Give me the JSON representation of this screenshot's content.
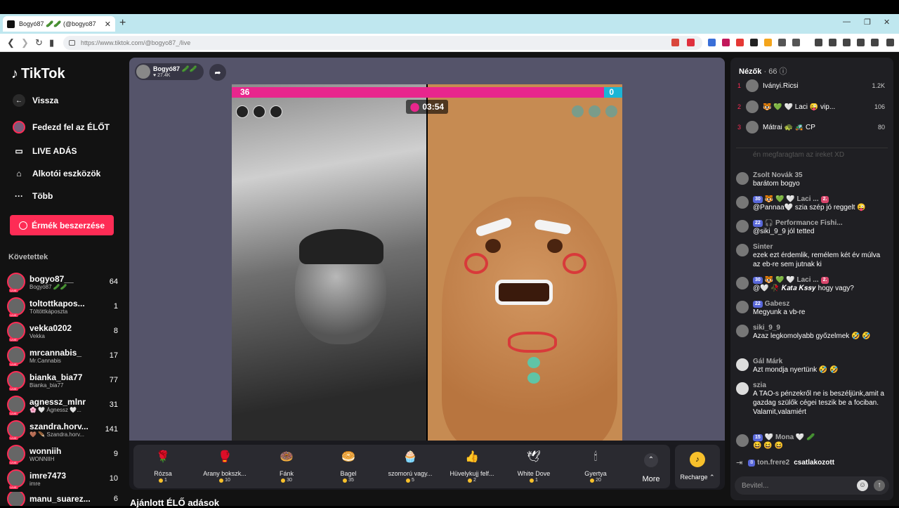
{
  "browser": {
    "tab_title": "Bogyó87 🥒🥒 (@bogyo87",
    "url": "https://www.tiktok.com/@bogyo87_/live"
  },
  "sidebar": {
    "logo": "TikTok",
    "nav": [
      {
        "label": "Vissza",
        "icon": "back-arrow-icon"
      },
      {
        "label": "Fedezd fel az ÉLŐT",
        "icon": "explore-live-icon"
      },
      {
        "label": "LIVE ADÁS",
        "icon": "video-camera-icon"
      },
      {
        "label": "Alkotói eszközök",
        "icon": "house-icon"
      },
      {
        "label": "Több",
        "icon": "more-icon"
      }
    ],
    "coin_button": "Érmék beszerzése",
    "following_label": "Követettek",
    "following": [
      {
        "name": "bogyo87__",
        "sub": "Bogyó87 🥒🥒",
        "count": "64"
      },
      {
        "name": "toltottkapos...",
        "sub": "Töltöttkáposzta",
        "count": "1"
      },
      {
        "name": "vekka0202",
        "sub": "Vekka",
        "count": "8"
      },
      {
        "name": "mrcannabis_",
        "sub": "Mr.Cannabis",
        "count": "17"
      },
      {
        "name": "bianka_bia77",
        "sub": "Bianka_bia77",
        "count": "77"
      },
      {
        "name": "agnessz_mlnr",
        "sub": "🌸 🤍 Ágnessz 🤍...",
        "count": "31"
      },
      {
        "name": "szandra.horv...",
        "sub": "🤎 🪶 Szandra.horv...",
        "count": "141"
      },
      {
        "name": "wonniih",
        "sub": "WONNIIH",
        "count": "9"
      },
      {
        "name": "imre7473",
        "sub": "imre",
        "count": "10"
      },
      {
        "name": "manu_suarez...",
        "sub": "",
        "count": "6"
      }
    ]
  },
  "stream": {
    "host_name": "Bogyó87 🥒🥒",
    "host_likes": "27.4K",
    "pk_left_score": "36",
    "pk_right_score": "0",
    "pk_fraction_left": 0.953,
    "timer": "03:54",
    "recommend_title": "Ajánlott ÉLŐ adások"
  },
  "gifts": [
    {
      "name": "Rózsa",
      "price": "1",
      "icon": "🌹"
    },
    {
      "name": "Arany bokszk...",
      "price": "10",
      "icon": "🥊"
    },
    {
      "name": "Fánk",
      "price": "30",
      "icon": "🍩"
    },
    {
      "name": "Bagel",
      "price": "35",
      "icon": "🥯"
    },
    {
      "name": "szomorú vagy...",
      "price": "5",
      "icon": "🧁"
    },
    {
      "name": "Hüvelykujj felf...",
      "price": "2",
      "icon": "👍"
    },
    {
      "name": "White Dove",
      "price": "1",
      "icon": "🕊"
    },
    {
      "name": "Gyertya",
      "price": "20",
      "icon": "🕯"
    }
  ],
  "gift_more": "More",
  "recharge": "Recharge",
  "chat": {
    "viewers_label": "Nézők",
    "viewers_count": "66",
    "top": [
      {
        "rank": "1",
        "name": "Iványi.Ricsi",
        "score": "1.2K"
      },
      {
        "rank": "2",
        "name": "🐯 💚 🤍 Laci 😜 vip...",
        "score": "106"
      },
      {
        "rank": "3",
        "name": "Mátrai 🐢 🚜 CP",
        "score": "80"
      }
    ],
    "faded_message": "én megfaragtam az ireket XD",
    "messages": [
      {
        "user": "Zsolt Novák 35",
        "badges": [],
        "text": "barátom bogyo"
      },
      {
        "user": "🐯 💚 🤍 Laci ...",
        "badges": [
          "30",
          "2."
        ],
        "text": "@Pannaa🤍 szia szép jó reggelt 😜"
      },
      {
        "user": "🎧 Performance Fishi...",
        "badges": [
          "22"
        ],
        "text": "@siki_9_9 jól tetted"
      },
      {
        "user": "Sinter",
        "badges": [],
        "text": "ezek ezt érdemlik, remélem két év múlva az eb-re sem jutnak ki"
      },
      {
        "user": "🐯 💚 🤍 Laci ...",
        "badges": [
          "30",
          "2."
        ],
        "text": "@🤍 🥀 𝑲𝒂𝒕𝒂 𝑲𝒔𝒔𝒚 hogy vagy?"
      },
      {
        "user": "Gabesz",
        "badges": [
          "22"
        ],
        "text": "Megyunk a vb-re"
      },
      {
        "user": "siki_9_9",
        "badges": [],
        "text": "Azaz legkomolyabb győzelmek 🤣 🤣"
      },
      {
        "user": "Gál Márk",
        "badges": [],
        "text": "Azt mondja nyertünk 🤣 🤣"
      },
      {
        "user": "szia",
        "badges": [],
        "text": "A TAO-s pénzekről ne is beszéljünk,amit a gazdag szülők cégei teszik be a fociban. Valamit,valamiért"
      },
      {
        "user": "🤍 Mona 🤍 🥒",
        "badges": [
          "15"
        ],
        "text": "😆 😆 😆"
      }
    ],
    "join": {
      "level": "8",
      "user": "ton.frere2",
      "action": "csatlakozott"
    },
    "input_placeholder": "Bevitel..."
  }
}
